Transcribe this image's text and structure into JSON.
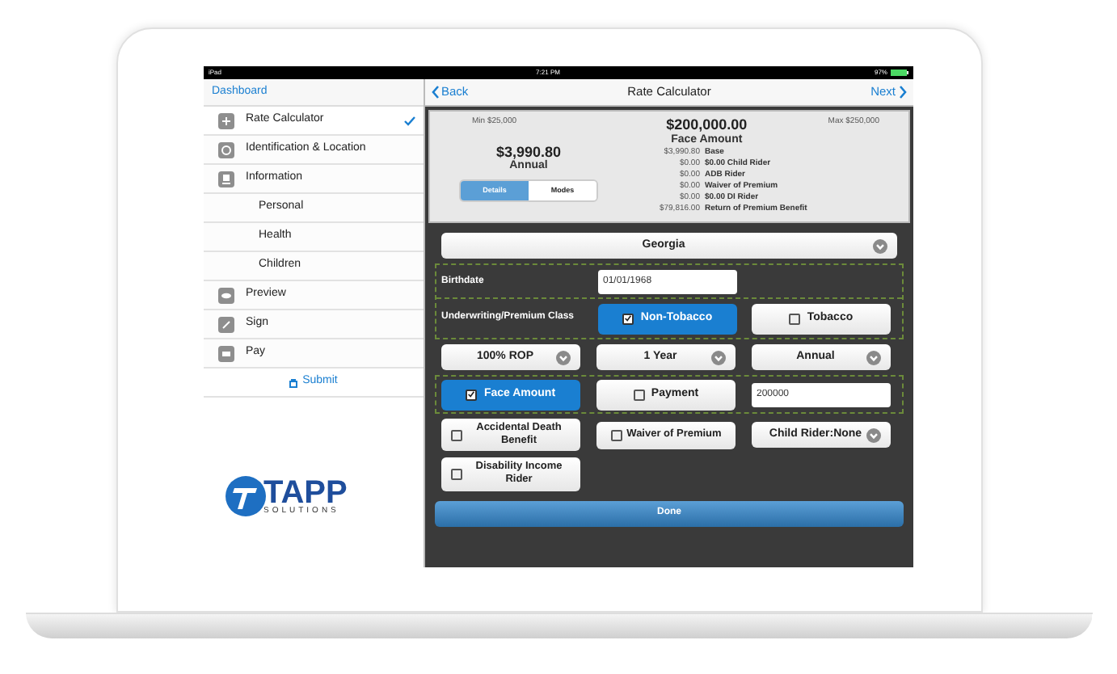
{
  "status_bar": {
    "device": "iPad",
    "time": "7:21 PM",
    "battery": "97%"
  },
  "sidebar": {
    "header": "Dashboard",
    "items": [
      {
        "label": "Rate Calculator",
        "selected": true
      },
      {
        "label": "Identification & Location",
        "selected": false
      },
      {
        "label": "Information",
        "selected": false,
        "children": [
          {
            "label": "Personal",
            "selected": false
          },
          {
            "label": "Health",
            "selected": false
          },
          {
            "label": "Children",
            "selected": false
          }
        ]
      },
      {
        "label": "Preview",
        "selected": false
      },
      {
        "label": "Sign",
        "selected": false
      },
      {
        "label": "Pay",
        "selected": false
      }
    ],
    "submit": "Submit"
  },
  "logo": {
    "name": "TAPP",
    "tagline": "SOLUTIONS"
  },
  "nav": {
    "back": "Back",
    "title": "Rate Calculator",
    "next": "Next"
  },
  "summary": {
    "min": "Min $25,000",
    "max": "Max $250,000",
    "face_amount": "$200,000.00",
    "face_label": "Face Amount",
    "premium": "$3,990.80",
    "premium_label": "Annual",
    "segments": [
      {
        "label": "Details",
        "selected": true
      },
      {
        "label": "Modes",
        "selected": false
      }
    ],
    "breakdown": [
      {
        "amount": "$3,990.80",
        "label": "Base"
      },
      {
        "amount": "$0.00",
        "label": "$0.00 Child Rider"
      },
      {
        "amount": "$0.00",
        "label": "ADB Rider"
      },
      {
        "amount": "$0.00",
        "label": "Waiver of Premium"
      },
      {
        "amount": "$0.00",
        "label": "$0.00 DI Rider"
      },
      {
        "amount": "$79,816.00",
        "label": "Return of Premium Benefit"
      }
    ]
  },
  "form": {
    "state": "Georgia",
    "birthdate": {
      "label": "Birthdate",
      "value": "01/01/1968"
    },
    "class": {
      "label": "Underwriting/Premium Class",
      "options": [
        {
          "label": "Non-Tobacco",
          "checked": true
        },
        {
          "label": "Tobacco",
          "checked": false
        }
      ]
    },
    "selects": [
      "100% ROP",
      "1 Year",
      "Annual"
    ],
    "amount": {
      "options": [
        {
          "label": "Face Amount",
          "checked": true
        },
        {
          "label": "Payment",
          "checked": false
        }
      ],
      "value": "200000"
    },
    "riders": [
      {
        "kind": "checkbox",
        "label": "Accidental Death Benefit",
        "checked": false
      },
      {
        "kind": "checkbox",
        "label": "Waiver of Premium",
        "checked": false
      },
      {
        "kind": "select",
        "label": "Child Rider:None"
      },
      {
        "kind": "checkbox",
        "label": "Disability Income Rider",
        "checked": false
      }
    ],
    "done": "Done"
  }
}
